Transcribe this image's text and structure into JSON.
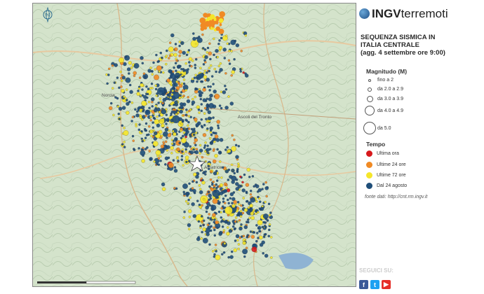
{
  "logo": {
    "brand": "INGV",
    "suffix": "terremoti"
  },
  "title": {
    "line1": "SEQUENZA SISMICA IN",
    "line2": "ITALIA CENTRALE",
    "line3": "(agg. 4 settembre ore 9:00)"
  },
  "magnitude": {
    "heading": "Magnitudo (M)",
    "items": [
      {
        "label": "fino a 2"
      },
      {
        "label": "da 2.0 a 2.9"
      },
      {
        "label": "da 3.0 a 3.9"
      },
      {
        "label": "da 4.0 a 4.9"
      },
      {
        "label": "da 5.0"
      }
    ]
  },
  "time": {
    "heading": "Tempo",
    "items": [
      {
        "label": "Ultima ora",
        "color": "#d7191c"
      },
      {
        "label": "Ultime 24 ore",
        "color": "#f08a24"
      },
      {
        "label": "Ultime 72 ore",
        "color": "#f5e62a"
      },
      {
        "label": "Dal 24 agosto",
        "color": "#1f4e79"
      }
    ]
  },
  "source": "fonte dati: http://cnt.rm.ingv.it",
  "follow": "SEGUICI SU:",
  "map": {
    "places": [
      "Norcia",
      "Ascoli del Tronto",
      "Amatrice"
    ],
    "north_label": "N",
    "epicenter_icon": "star-icon"
  }
}
